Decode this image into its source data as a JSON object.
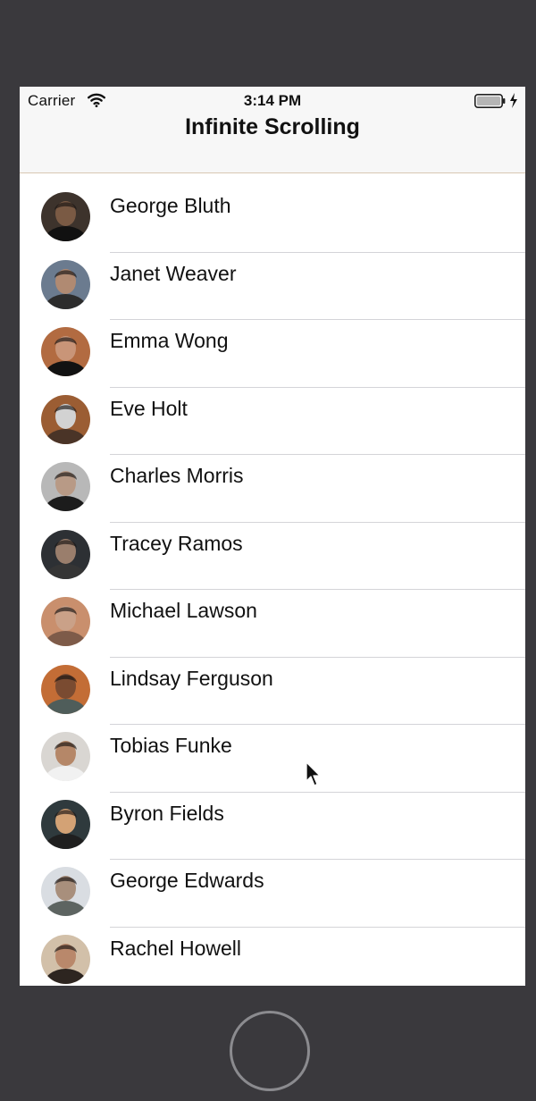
{
  "status_bar": {
    "carrier": "Carrier",
    "time": "3:14 PM"
  },
  "nav": {
    "title": "Infinite Scrolling"
  },
  "contacts": [
    {
      "name": "George Bluth",
      "bg": "#3d332c",
      "skin": "#7a5a44",
      "shirt": "#111111"
    },
    {
      "name": "Janet Weaver",
      "bg": "#6b7b8f",
      "skin": "#b08a72",
      "shirt": "#2c2c2c"
    },
    {
      "name": "Emma Wong",
      "bg": "#b26b41",
      "skin": "#c99578",
      "shirt": "#121212"
    },
    {
      "name": "Eve Holt",
      "bg": "#9b5d33",
      "skin": "#d2d2d2",
      "shirt": "#4a3427"
    },
    {
      "name": "Charles Morris",
      "bg": "#b8b8b8",
      "skin": "#b89a86",
      "shirt": "#1c1c1c"
    },
    {
      "name": "Tracey Ramos",
      "bg": "#2d3034",
      "skin": "#9a7e6c",
      "shirt": "#353535"
    },
    {
      "name": "Michael Lawson",
      "bg": "#c98f6d",
      "skin": "#caa188",
      "shirt": "#7e5b49"
    },
    {
      "name": "Lindsay Ferguson",
      "bg": "#c36d36",
      "skin": "#7a4b31",
      "shirt": "#4f5d5a"
    },
    {
      "name": "Tobias Funke",
      "bg": "#d9d6d2",
      "skin": "#b58768",
      "shirt": "#f1f1f1"
    },
    {
      "name": "Byron Fields",
      "bg": "#2f3a3d",
      "skin": "#d3a275",
      "shirt": "#1f1f1f"
    },
    {
      "name": "George Edwards",
      "bg": "#d9dde2",
      "skin": "#a88f7c",
      "shirt": "#5d6461"
    },
    {
      "name": "Rachel Howell",
      "bg": "#d2c0a9",
      "skin": "#b9886b",
      "shirt": "#2d2520"
    }
  ],
  "colors": {
    "outer_frame": "#3a393d",
    "nav_background": "#f7f7f7",
    "separator": "#d4d4d8",
    "home_button_ring": "#8b8b8f"
  },
  "icons": {
    "wifi": "wifi-icon",
    "battery": "battery-icon",
    "charging": "charging-bolt-icon",
    "cursor": "mouse-cursor-icon",
    "avatar": "avatar-photo"
  }
}
